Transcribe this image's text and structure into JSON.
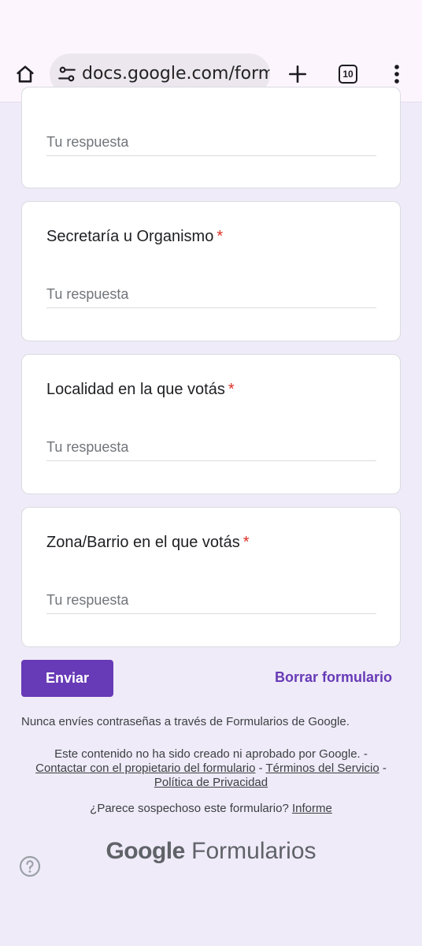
{
  "browser": {
    "url": "docs.google.com/forms",
    "tab_count": "10",
    "icons": [
      "home-icon",
      "site-settings-icon",
      "add-icon",
      "tab-switcher-icon",
      "more-vert-icon"
    ]
  },
  "form": {
    "first_card": {
      "answer_placeholder": "Tu respuesta"
    },
    "questions": [
      {
        "label": "Secretaría u Organismo",
        "required_mark": "*",
        "placeholder": "Tu respuesta"
      },
      {
        "label": "Localidad en la que votás",
        "required_mark": "*",
        "placeholder": "Tu respuesta"
      },
      {
        "label": "Zona/Barrio en el que votás",
        "required_mark": "*",
        "placeholder": "Tu respuesta"
      }
    ],
    "submit_label": "Enviar",
    "clear_label": "Borrar formulario"
  },
  "footer": {
    "password_warning": "Nunca envíes contraseñas a través de Formularios de Google.",
    "disclaimer_text": "Este contenido no ha sido creado ni aprobado por Google. -",
    "contact_link": "Contactar con el propietario del formulario",
    "sep1": " - ",
    "terms_link": "Términos del Servicio",
    "sep2": " - ",
    "privacy_link": "Política de Privacidad",
    "suspicious_text": "¿Parece sospechoso este formulario?",
    "report_link": "Informe",
    "brand_google": "Google",
    "brand_product": "Formularios"
  },
  "colors": {
    "accent": "#673ab7",
    "required": "#d93025",
    "page_bg": "#efebf8"
  }
}
